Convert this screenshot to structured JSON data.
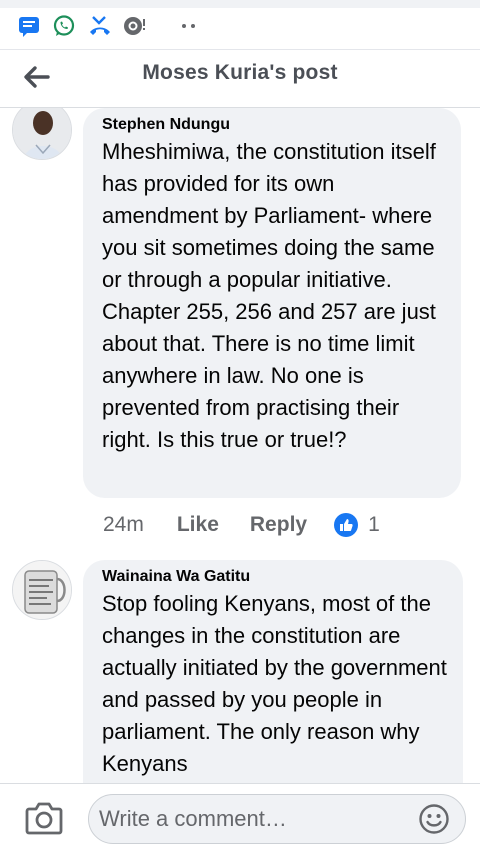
{
  "header": {
    "title": "Moses Kuria's post"
  },
  "status_icons": [
    "message-icon",
    "whatsapp-icon",
    "missed-call-icon",
    "notification-icon",
    "more-dots-icon"
  ],
  "comments": [
    {
      "author": "Stephen Ndungu",
      "text": "Mheshimiwa, the constitution itself has provided for its own amendment by Parliament- where you sit sometimes doing the same or through a popular initiative. Chapter 255, 256 and 257 are just about that. There is no time limit anywhere in law. No one is prevented from practising their right. Is this true or true!?",
      "time": "24m",
      "like_label": "Like",
      "reply_label": "Reply",
      "reaction_count": "1"
    },
    {
      "author": "Wainaina Wa Gatitu",
      "text": "Stop fooling Kenyans, most of the changes in the constitution are actually initiated by the government and passed by you people in parliament. The only reason why Kenyans"
    }
  ],
  "composer": {
    "placeholder": "Write a comment…"
  },
  "colors": {
    "accent": "#1877f2",
    "bubble": "#f0f2f5",
    "secondary_text": "#65676b",
    "whatsapp": "#25d366"
  }
}
